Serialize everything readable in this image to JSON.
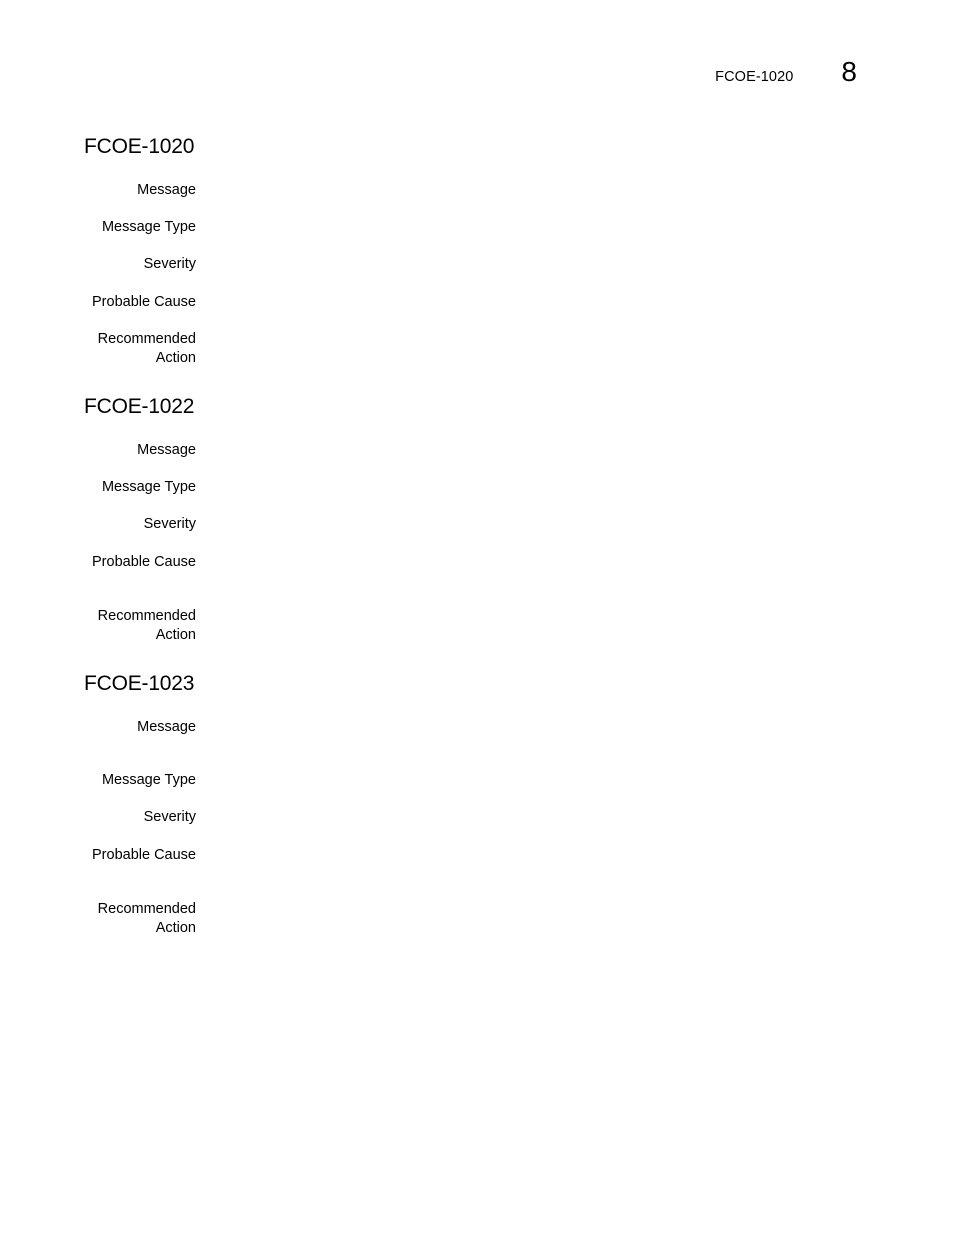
{
  "header": {
    "running_title": "FCOE-1020",
    "chapter_number": "8"
  },
  "sections": [
    {
      "title": "FCOE-1020",
      "fields": [
        {
          "label": "Message",
          "value": ""
        },
        {
          "label": "Message Type",
          "value": ""
        },
        {
          "label": "Severity",
          "value": ""
        },
        {
          "label": "Probable Cause",
          "value": ""
        },
        {
          "label": "Recommended Action",
          "value": ""
        }
      ]
    },
    {
      "title": "FCOE-1022",
      "fields": [
        {
          "label": "Message",
          "value": ""
        },
        {
          "label": "Message Type",
          "value": ""
        },
        {
          "label": "Severity",
          "value": ""
        },
        {
          "label": "Probable Cause",
          "value": ""
        },
        {
          "label": "Recommended Action",
          "value": ""
        }
      ]
    },
    {
      "title": "FCOE-1023",
      "fields": [
        {
          "label": "Message",
          "value": ""
        },
        {
          "label": "Message Type",
          "value": ""
        },
        {
          "label": "Severity",
          "value": ""
        },
        {
          "label": "Probable Cause",
          "value": ""
        },
        {
          "label": "Recommended Action",
          "value": ""
        }
      ]
    }
  ]
}
